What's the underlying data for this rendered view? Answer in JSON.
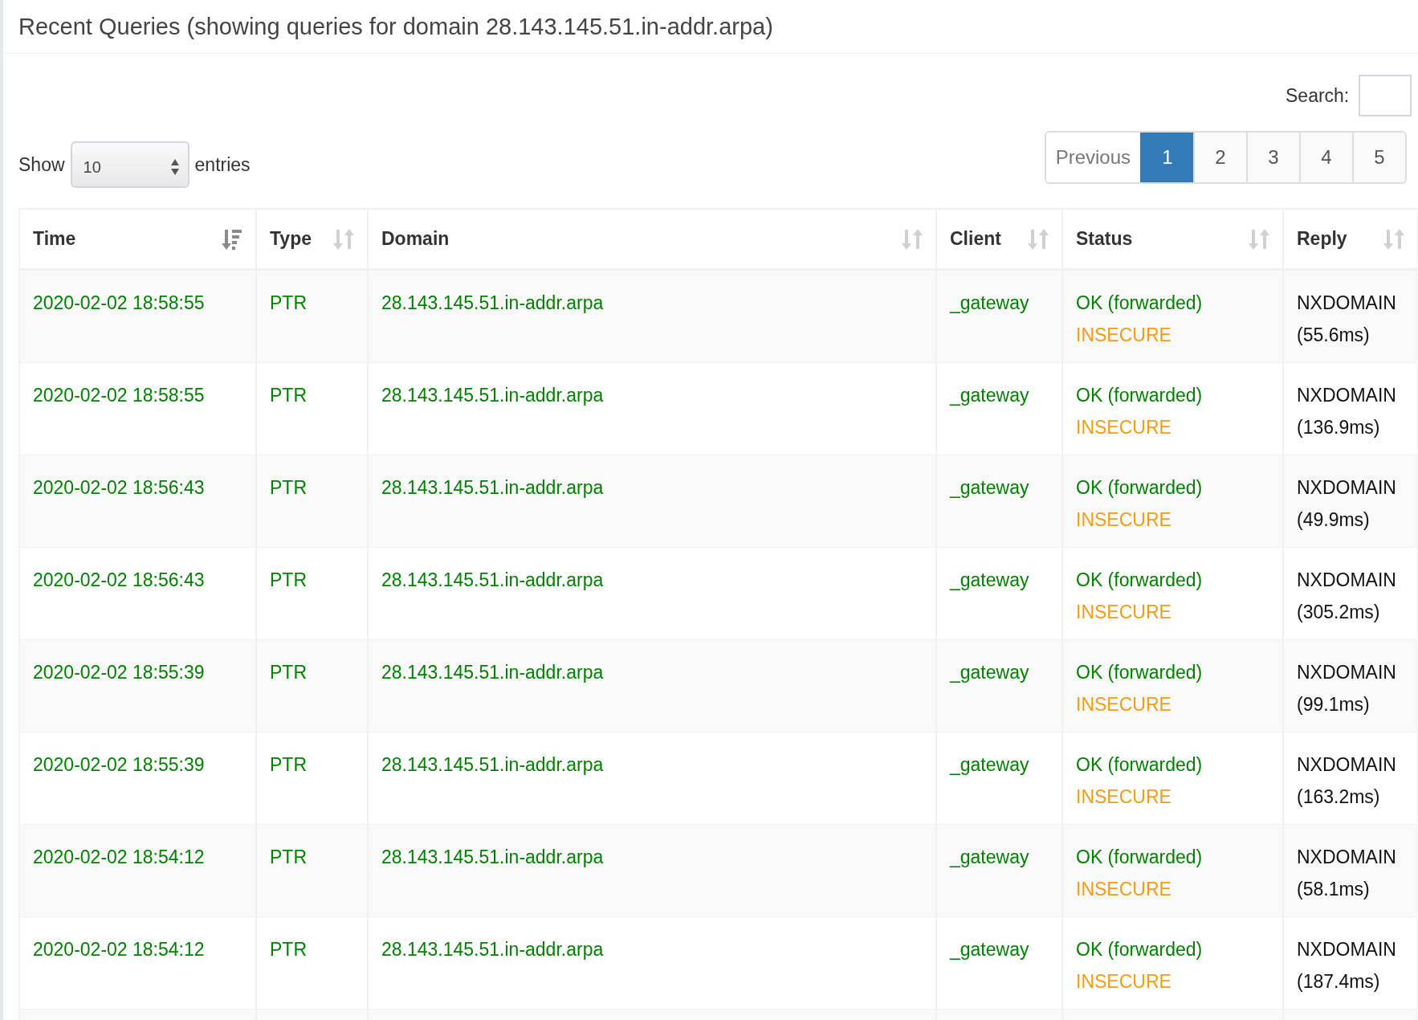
{
  "title": "Recent Queries (showing queries for domain 28.143.145.51.in-addr.arpa)",
  "search": {
    "label": "Search:"
  },
  "length": {
    "prefix": "Show",
    "value": "10",
    "suffix": "entries"
  },
  "pagination": [
    {
      "label": "Previous",
      "selected": false,
      "disabled": true
    },
    {
      "label": "1",
      "selected": true,
      "disabled": false
    },
    {
      "label": "2",
      "selected": false,
      "disabled": false
    },
    {
      "label": "3",
      "selected": false,
      "disabled": false
    },
    {
      "label": "4",
      "selected": false,
      "disabled": false
    },
    {
      "label": "5",
      "selected": false,
      "disabled": false
    }
  ],
  "table": {
    "columns": [
      {
        "label": "Time",
        "sorted": true
      },
      {
        "label": "Type",
        "sorted": false
      },
      {
        "label": "Domain",
        "sorted": false
      },
      {
        "label": "Client",
        "sorted": false
      },
      {
        "label": "Status",
        "sorted": false
      },
      {
        "label": "Reply",
        "sorted": false
      }
    ],
    "rows": [
      {
        "time": "2020-02-02 18:58:55",
        "type": "PTR",
        "domain": "28.143.145.51.in-addr.arpa",
        "client": "_gateway",
        "status": "OK (forwarded)",
        "dnssec": "INSECURE",
        "reply": "NXDOMAIN",
        "duration": "(55.6ms)"
      },
      {
        "time": "2020-02-02 18:58:55",
        "type": "PTR",
        "domain": "28.143.145.51.in-addr.arpa",
        "client": "_gateway",
        "status": "OK (forwarded)",
        "dnssec": "INSECURE",
        "reply": "NXDOMAIN",
        "duration": "(136.9ms)"
      },
      {
        "time": "2020-02-02 18:56:43",
        "type": "PTR",
        "domain": "28.143.145.51.in-addr.arpa",
        "client": "_gateway",
        "status": "OK (forwarded)",
        "dnssec": "INSECURE",
        "reply": "NXDOMAIN",
        "duration": "(49.9ms)"
      },
      {
        "time": "2020-02-02 18:56:43",
        "type": "PTR",
        "domain": "28.143.145.51.in-addr.arpa",
        "client": "_gateway",
        "status": "OK (forwarded)",
        "dnssec": "INSECURE",
        "reply": "NXDOMAIN",
        "duration": "(305.2ms)"
      },
      {
        "time": "2020-02-02 18:55:39",
        "type": "PTR",
        "domain": "28.143.145.51.in-addr.arpa",
        "client": "_gateway",
        "status": "OK (forwarded)",
        "dnssec": "INSECURE",
        "reply": "NXDOMAIN",
        "duration": "(99.1ms)"
      },
      {
        "time": "2020-02-02 18:55:39",
        "type": "PTR",
        "domain": "28.143.145.51.in-addr.arpa",
        "client": "_gateway",
        "status": "OK (forwarded)",
        "dnssec": "INSECURE",
        "reply": "NXDOMAIN",
        "duration": "(163.2ms)"
      },
      {
        "time": "2020-02-02 18:54:12",
        "type": "PTR",
        "domain": "28.143.145.51.in-addr.arpa",
        "client": "_gateway",
        "status": "OK (forwarded)",
        "dnssec": "INSECURE",
        "reply": "NXDOMAIN",
        "duration": "(58.1ms)"
      },
      {
        "time": "2020-02-02 18:54:12",
        "type": "PTR",
        "domain": "28.143.145.51.in-addr.arpa",
        "client": "_gateway",
        "status": "OK (forwarded)",
        "dnssec": "INSECURE",
        "reply": "NXDOMAIN",
        "duration": "(187.4ms)"
      }
    ]
  }
}
